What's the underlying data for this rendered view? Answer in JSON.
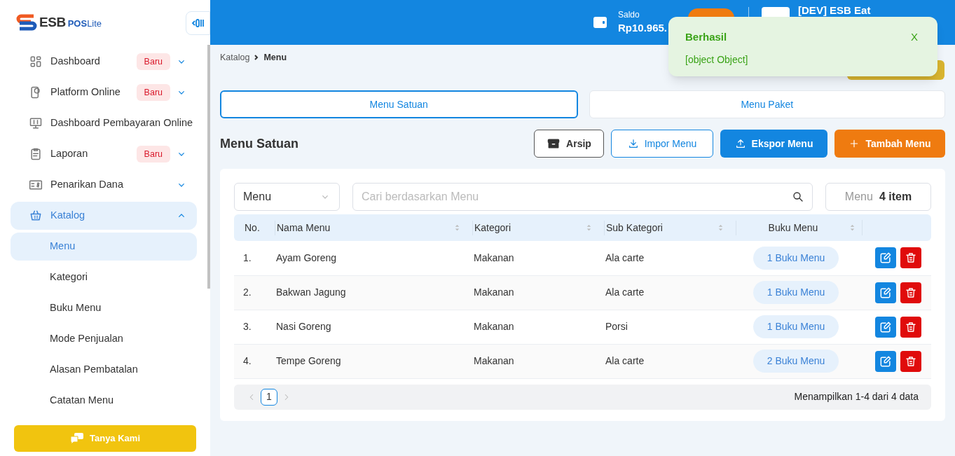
{
  "logo": {
    "brand": "ESB",
    "product": "POS",
    "suffix": "Lite"
  },
  "sidebar": {
    "items": [
      {
        "label": "Dashboard",
        "badge": "Baru",
        "expanded": false,
        "selected": false
      },
      {
        "label": "Platform Online",
        "badge": "Baru",
        "expanded": false,
        "selected": false
      },
      {
        "label": "Dashboard Pembayaran Online",
        "selected": false
      },
      {
        "label": "Laporan",
        "badge": "Baru",
        "expanded": false,
        "selected": false
      },
      {
        "label": "Penarikan Dana",
        "expanded": false,
        "selected": false
      },
      {
        "label": "Katalog",
        "expanded": true,
        "selected": true,
        "children": [
          {
            "label": "Menu",
            "selected": true
          },
          {
            "label": "Kategori",
            "selected": false
          },
          {
            "label": "Buku Menu",
            "selected": false
          },
          {
            "label": "Mode Penjualan",
            "selected": false
          },
          {
            "label": "Alasan Pembatalan",
            "selected": false
          },
          {
            "label": "Catatan Menu",
            "selected": false
          }
        ]
      }
    ],
    "help_button": "Tanya Kami"
  },
  "header": {
    "balance_label": "Saldo",
    "balance": "Rp10.965.",
    "store": "[DEV] ESB Eat"
  },
  "toast": {
    "title": "Berhasil",
    "message": "[object Object]",
    "close": "X"
  },
  "breadcrumb": [
    "Katalog",
    "Menu"
  ],
  "tabs": [
    {
      "label": "Menu Satuan",
      "selected": true
    },
    {
      "label": "Menu Paket",
      "selected": false
    }
  ],
  "title": "Menu Satuan",
  "actions": [
    {
      "label": "Arsip",
      "kind": "archive"
    },
    {
      "label": "Impor Menu",
      "kind": "import"
    },
    {
      "label": "Ekspor Menu",
      "kind": "export"
    },
    {
      "label": "Tambah Menu",
      "kind": "add"
    }
  ],
  "filter": {
    "select": "Menu",
    "placeholder": "Cari berdasarkan Menu",
    "count_label": "Menu",
    "count": "4 item"
  },
  "table": {
    "columns": [
      "No.",
      "Nama Menu",
      "Kategori",
      "Sub Kategori",
      "Buku Menu"
    ],
    "rows": [
      {
        "no": "1.",
        "name": "Ayam Goreng",
        "category": "Makanan",
        "sub": "Ala carte",
        "books": "1 Buku Menu"
      },
      {
        "no": "2.",
        "name": "Bakwan Jagung",
        "category": "Makanan",
        "sub": "Ala carte",
        "books": "1 Buku Menu"
      },
      {
        "no": "3.",
        "name": "Nasi Goreng",
        "category": "Makanan",
        "sub": "Porsi",
        "books": "1 Buku Menu"
      },
      {
        "no": "4.",
        "name": "Tempe Goreng",
        "category": "Makanan",
        "sub": "Ala carte",
        "books": "2 Buku Menu"
      }
    ]
  },
  "pagination": {
    "pages": [
      {
        "label": "1",
        "selected": true
      }
    ],
    "summary": "Menampilkan 1-4 dari 4 data"
  }
}
